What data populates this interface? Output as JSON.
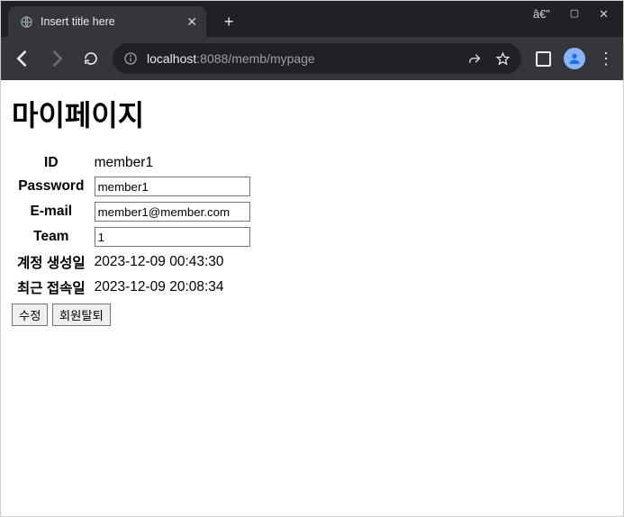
{
  "browser": {
    "tab_title": "Insert title here",
    "url_host": "localhost",
    "url_port_path": ":8088/memb/mypage"
  },
  "page": {
    "heading": "마이페이지",
    "labels": {
      "id": "ID",
      "password": "Password",
      "email": "E-mail",
      "team": "Team",
      "created": "계정 생성일",
      "lastlogin": "최근 접속일"
    },
    "values": {
      "id": "member1",
      "password": "member1",
      "email": "member1@member.com",
      "team": "1",
      "created": "2023-12-09 00:43:30",
      "lastlogin": "2023-12-09 20:08:34"
    },
    "buttons": {
      "edit": "수정",
      "withdraw": "회원탈퇴"
    }
  }
}
